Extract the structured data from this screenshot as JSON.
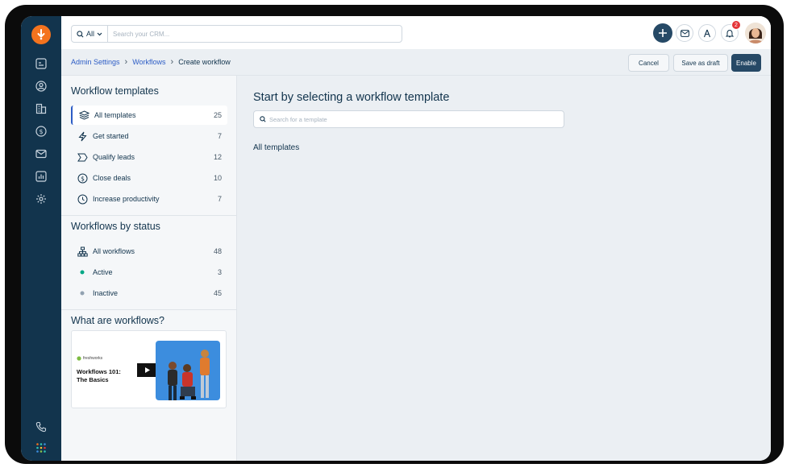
{
  "search": {
    "scope": "All",
    "placeholder": "Search your CRM..."
  },
  "notifications": {
    "count": "2"
  },
  "breadcrumb": {
    "admin": "Admin Settings",
    "workflows": "Workflows",
    "current": "Create workflow"
  },
  "actions": {
    "cancel": "Cancel",
    "save_draft": "Save as draft",
    "enable": "Enable"
  },
  "sidebar": {
    "templates_title": "Workflow templates",
    "templates": [
      {
        "label": "All templates",
        "count": "25"
      },
      {
        "label": "Get started",
        "count": "7"
      },
      {
        "label": "Qualify leads",
        "count": "12"
      },
      {
        "label": "Close deals",
        "count": "10"
      },
      {
        "label": "Increase productivity",
        "count": "7"
      }
    ],
    "status_title": "Workflows by status",
    "status": [
      {
        "label": "All workflows",
        "count": "48"
      },
      {
        "label": "Active",
        "count": "3"
      },
      {
        "label": "Inactive",
        "count": "45"
      }
    ],
    "what_title": "What are workflows?",
    "video": {
      "brand": "freshworks",
      "title_line1": "Workflows 101:",
      "title_line2": "The Basics"
    }
  },
  "main": {
    "title": "Start by selecting a workflow template",
    "search_placeholder": "Search for a template",
    "section_label": "All templates"
  },
  "colors": {
    "rail": "#12344d",
    "accent": "#2c5cc5",
    "logo": "#f4731e",
    "active_dot": "#00a886",
    "inactive_dot": "#92a2b1",
    "enable_button": "#264966",
    "badge": "#e43538"
  }
}
